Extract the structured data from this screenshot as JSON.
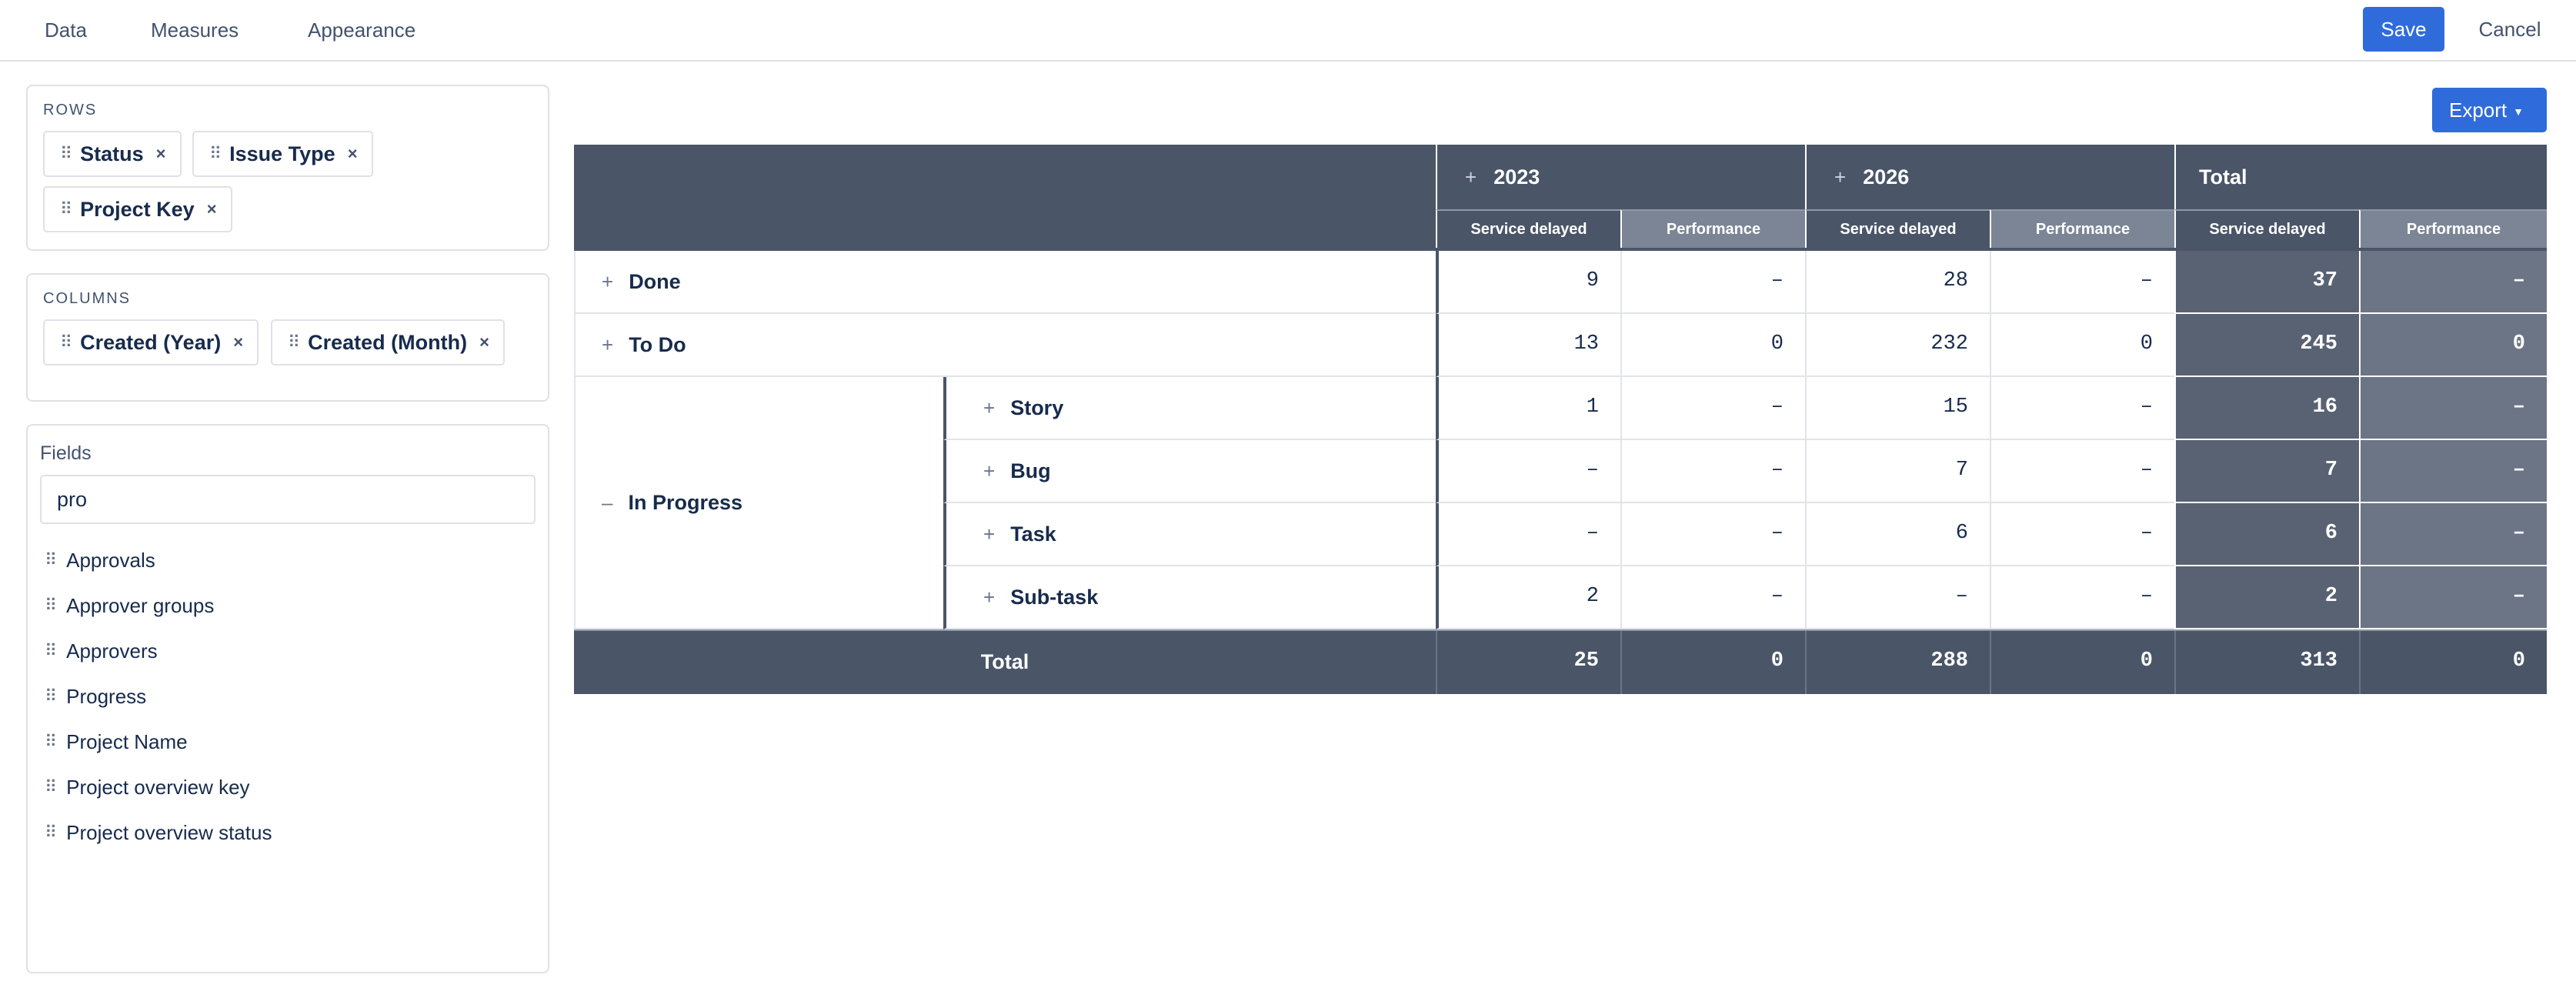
{
  "topbar": {
    "tabs": [
      "Data",
      "Measures",
      "Appearance"
    ],
    "save_label": "Save",
    "cancel_label": "Cancel"
  },
  "rows_panel": {
    "label": "ROWS",
    "chips": [
      "Status",
      "Issue Type",
      "Project Key"
    ]
  },
  "columns_panel": {
    "label": "COLUMNS",
    "chips": [
      "Created (Year)",
      "Created (Month)"
    ]
  },
  "fields_panel": {
    "title": "Fields",
    "search_value": "pro",
    "items": [
      "Approvals",
      "Approver groups",
      "Approvers",
      "Progress",
      "Project Name",
      "Project overview key",
      "Project overview status"
    ]
  },
  "export_label": "Export",
  "pivot": {
    "column_groups": [
      "2023",
      "2026",
      "Total"
    ],
    "measures": [
      "Service delayed",
      "Performance"
    ],
    "rows": [
      {
        "label": "Done",
        "values": [
          "9",
          "–",
          "28",
          "–",
          "37",
          "–"
        ]
      },
      {
        "label": "To Do",
        "values": [
          "13",
          "0",
          "232",
          "0",
          "245",
          "0"
        ]
      }
    ],
    "group": {
      "label": "In Progress",
      "subrows": [
        {
          "label": "Story",
          "values": [
            "1",
            "–",
            "15",
            "–",
            "16",
            "–"
          ]
        },
        {
          "label": "Bug",
          "values": [
            "–",
            "–",
            "7",
            "–",
            "7",
            "–"
          ]
        },
        {
          "label": "Task",
          "values": [
            "–",
            "–",
            "6",
            "–",
            "6",
            "–"
          ]
        },
        {
          "label": "Sub-task",
          "values": [
            "2",
            "–",
            "–",
            "–",
            "2",
            "–"
          ]
        }
      ]
    },
    "total": {
      "label": "Total",
      "values": [
        "25",
        "0",
        "288",
        "0",
        "313",
        "0"
      ]
    }
  },
  "colors": {
    "accent": "#2f6bdb",
    "header_dark": "#4a5568",
    "header_mid": "#7b8595"
  }
}
